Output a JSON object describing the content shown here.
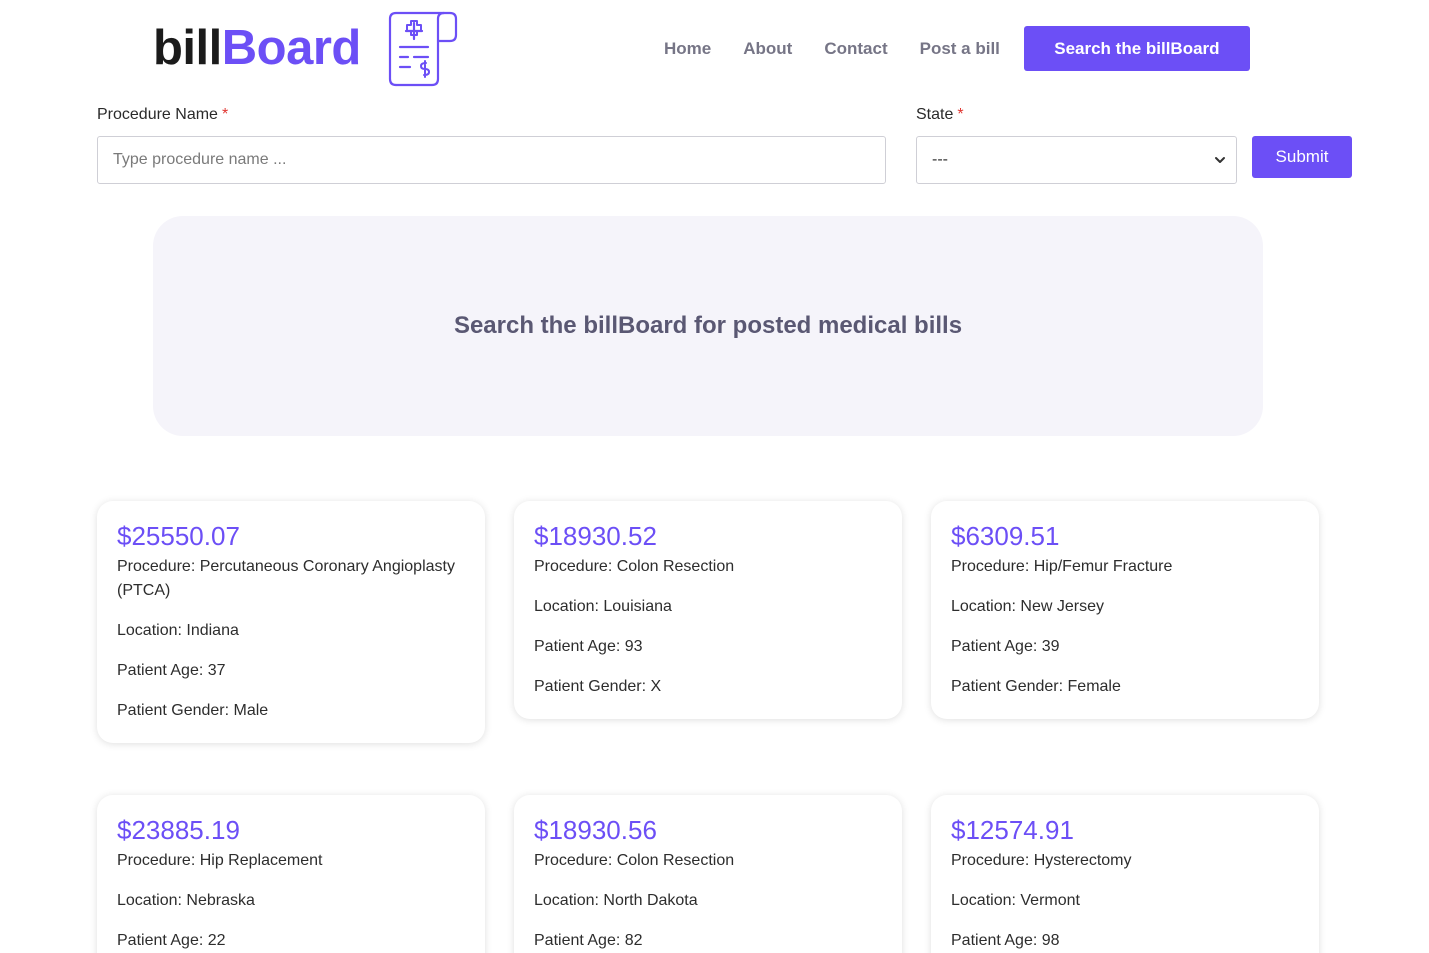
{
  "brand": {
    "part1": "bill",
    "part2": "Board",
    "icon": "medical-bill-icon"
  },
  "nav": {
    "items": [
      "Home",
      "About",
      "Contact",
      "Post a bill"
    ],
    "cta": "Search the billBoard"
  },
  "form": {
    "procedure_label": "Procedure Name",
    "procedure_placeholder": "Type procedure name ...",
    "state_label": "State",
    "required_mark": "*",
    "state_selected": "---",
    "submit": "Submit"
  },
  "hero": {
    "title": "Search the billBoard for posted medical bills"
  },
  "cards": [
    {
      "price": "$25550.07",
      "procedure": "Procedure: Percutaneous Coronary Angioplasty (PTCA)",
      "location": "Location: Indiana",
      "age": "Patient Age: 37",
      "gender": "Patient Gender: Male"
    },
    {
      "price": "$18930.52",
      "procedure": "Procedure: Colon Resection",
      "location": "Location: Louisiana",
      "age": "Patient Age: 93",
      "gender": "Patient Gender: X"
    },
    {
      "price": "$6309.51",
      "procedure": "Procedure: Hip/Femur Fracture",
      "location": "Location: New Jersey",
      "age": "Patient Age: 39",
      "gender": "Patient Gender: Female"
    },
    {
      "price": "$23885.19",
      "procedure": "Procedure: Hip Replacement",
      "location": "Location: Nebraska",
      "age": "Patient Age: 22",
      "gender": ""
    },
    {
      "price": "$18930.56",
      "procedure": "Procedure: Colon Resection",
      "location": "Location: North Dakota",
      "age": "Patient Age: 82",
      "gender": ""
    },
    {
      "price": "$12574.91",
      "procedure": "Procedure: Hysterectomy",
      "location": "Location: Vermont",
      "age": "Patient Age: 98",
      "gender": ""
    }
  ],
  "colors": {
    "accent": "#6c4ff6",
    "hero_bg": "#f5f4fa",
    "nav_text": "#767586"
  }
}
